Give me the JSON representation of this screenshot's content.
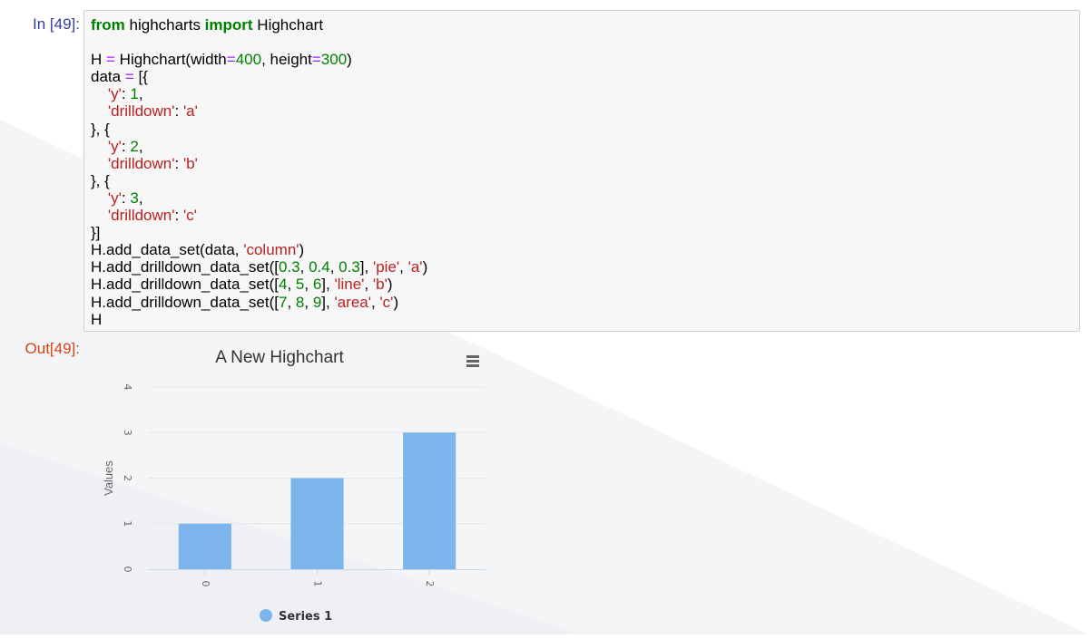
{
  "input_cell": {
    "prompt": "In [49]:",
    "code_lines": [
      [
        {
          "t": "kw",
          "v": "from"
        },
        {
          "t": "txt",
          "v": " highcharts "
        },
        {
          "t": "kw",
          "v": "import"
        },
        {
          "t": "txt",
          "v": " Highchart"
        }
      ],
      [
        {
          "t": "txt",
          "v": ""
        }
      ],
      [
        {
          "t": "txt",
          "v": "H "
        },
        {
          "t": "op",
          "v": "="
        },
        {
          "t": "txt",
          "v": " Highchart(width"
        },
        {
          "t": "op",
          "v": "="
        },
        {
          "t": "num",
          "v": "400"
        },
        {
          "t": "txt",
          "v": ", height"
        },
        {
          "t": "op",
          "v": "="
        },
        {
          "t": "num",
          "v": "300"
        },
        {
          "t": "txt",
          "v": ")"
        }
      ],
      [
        {
          "t": "txt",
          "v": "data "
        },
        {
          "t": "op",
          "v": "="
        },
        {
          "t": "txt",
          "v": " [{"
        }
      ],
      [
        {
          "t": "txt",
          "v": "    "
        },
        {
          "t": "str",
          "v": "'y'"
        },
        {
          "t": "txt",
          "v": ": "
        },
        {
          "t": "num",
          "v": "1"
        },
        {
          "t": "txt",
          "v": ","
        }
      ],
      [
        {
          "t": "txt",
          "v": "    "
        },
        {
          "t": "str",
          "v": "'drilldown'"
        },
        {
          "t": "txt",
          "v": ": "
        },
        {
          "t": "str",
          "v": "'a'"
        }
      ],
      [
        {
          "t": "txt",
          "v": "}, {"
        }
      ],
      [
        {
          "t": "txt",
          "v": "    "
        },
        {
          "t": "str",
          "v": "'y'"
        },
        {
          "t": "txt",
          "v": ": "
        },
        {
          "t": "num",
          "v": "2"
        },
        {
          "t": "txt",
          "v": ","
        }
      ],
      [
        {
          "t": "txt",
          "v": "    "
        },
        {
          "t": "str",
          "v": "'drilldown'"
        },
        {
          "t": "txt",
          "v": ": "
        },
        {
          "t": "str",
          "v": "'b'"
        }
      ],
      [
        {
          "t": "txt",
          "v": "}, {"
        }
      ],
      [
        {
          "t": "txt",
          "v": "    "
        },
        {
          "t": "str",
          "v": "'y'"
        },
        {
          "t": "txt",
          "v": ": "
        },
        {
          "t": "num",
          "v": "3"
        },
        {
          "t": "txt",
          "v": ","
        }
      ],
      [
        {
          "t": "txt",
          "v": "    "
        },
        {
          "t": "str",
          "v": "'drilldown'"
        },
        {
          "t": "txt",
          "v": ": "
        },
        {
          "t": "str",
          "v": "'c'"
        }
      ],
      [
        {
          "t": "txt",
          "v": "}]"
        }
      ],
      [
        {
          "t": "txt",
          "v": "H.add_data_set(data, "
        },
        {
          "t": "str",
          "v": "'column'"
        },
        {
          "t": "txt",
          "v": ")"
        }
      ],
      [
        {
          "t": "txt",
          "v": "H.add_drilldown_data_set(["
        },
        {
          "t": "num",
          "v": "0.3"
        },
        {
          "t": "txt",
          "v": ", "
        },
        {
          "t": "num",
          "v": "0.4"
        },
        {
          "t": "txt",
          "v": ", "
        },
        {
          "t": "num",
          "v": "0.3"
        },
        {
          "t": "txt",
          "v": "], "
        },
        {
          "t": "str",
          "v": "'pie'"
        },
        {
          "t": "txt",
          "v": ", "
        },
        {
          "t": "str",
          "v": "'a'"
        },
        {
          "t": "txt",
          "v": ")"
        }
      ],
      [
        {
          "t": "txt",
          "v": "H.add_drilldown_data_set(["
        },
        {
          "t": "num",
          "v": "4"
        },
        {
          "t": "txt",
          "v": ", "
        },
        {
          "t": "num",
          "v": "5"
        },
        {
          "t": "txt",
          "v": ", "
        },
        {
          "t": "num",
          "v": "6"
        },
        {
          "t": "txt",
          "v": "], "
        },
        {
          "t": "str",
          "v": "'line'"
        },
        {
          "t": "txt",
          "v": ", "
        },
        {
          "t": "str",
          "v": "'b'"
        },
        {
          "t": "txt",
          "v": ")"
        }
      ],
      [
        {
          "t": "txt",
          "v": "H.add_drilldown_data_set(["
        },
        {
          "t": "num",
          "v": "7"
        },
        {
          "t": "txt",
          "v": ", "
        },
        {
          "t": "num",
          "v": "8"
        },
        {
          "t": "txt",
          "v": ", "
        },
        {
          "t": "num",
          "v": "9"
        },
        {
          "t": "txt",
          "v": "], "
        },
        {
          "t": "str",
          "v": "'area'"
        },
        {
          "t": "txt",
          "v": ", "
        },
        {
          "t": "str",
          "v": "'c'"
        },
        {
          "t": "txt",
          "v": ")"
        }
      ],
      [
        {
          "t": "txt",
          "v": "H"
        }
      ]
    ]
  },
  "output_cell": {
    "prompt": "Out[49]:"
  },
  "colors": {
    "bar": "#7cb5ec",
    "grid": "#e6e6e6",
    "axis_line": "#ccd6eb",
    "tick_text": "#666666",
    "title": "#333333",
    "legend_text": "#333333"
  },
  "icons": {
    "menu": "hamburger-menu-icon",
    "legend_marker": "circle"
  },
  "chart_data": {
    "type": "bar",
    "title": "A New Highchart",
    "xlabel": "",
    "ylabel": "Values",
    "categories": [
      "0",
      "1",
      "2"
    ],
    "series": [
      {
        "name": "Series 1",
        "values": [
          1,
          2,
          3
        ]
      }
    ],
    "ylim": [
      0,
      4
    ],
    "yticks": [
      "0",
      "1",
      "2",
      "3",
      "4"
    ],
    "grid": true,
    "legend": "bottom-center"
  }
}
